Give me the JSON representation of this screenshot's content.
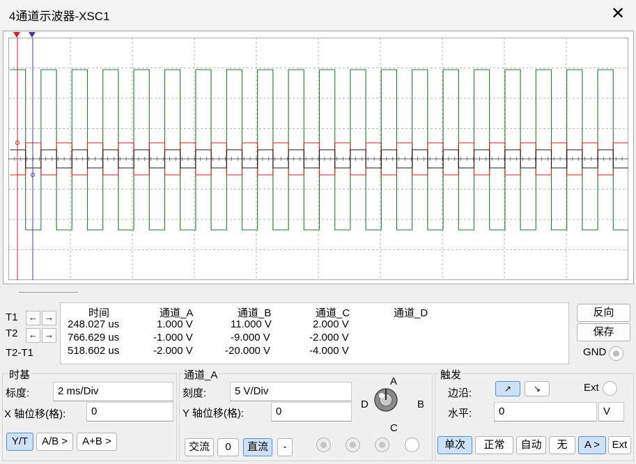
{
  "window": {
    "title": "4通道示波器-XSC1",
    "close_glyph": "✕"
  },
  "colors": {
    "channel_a": "#d42020",
    "channel_b": "#1e7d2e",
    "channel_c": "#1a1a1a",
    "cursor_t1": "#d42020",
    "cursor_t2": "#3a3aa8",
    "grid": "#a0a0a0"
  },
  "cursors": {
    "t1_flag": "1",
    "t2_flag": "2"
  },
  "readout": {
    "headers": [
      "时间",
      "通道_A",
      "通道_B",
      "通道_C",
      "通道_D"
    ],
    "row_labels": [
      "T1",
      "T2",
      "T2-T1"
    ],
    "rows": [
      [
        "248.027 us",
        "1.000 V",
        "11.000 V",
        "2.000 V",
        ""
      ],
      [
        "766.629 us",
        "-1.000 V",
        "-9.000 V",
        "-2.000 V",
        ""
      ],
      [
        "518.602 us",
        "-2.000 V",
        "-20.000 V",
        "-4.000 V",
        ""
      ]
    ],
    "left_arrow": "←",
    "right_arrow": "→"
  },
  "side_buttons": {
    "reverse": "反向",
    "save": "保存",
    "gnd": "GND"
  },
  "timebase": {
    "title": "时基",
    "scale_label": "标度:",
    "scale_value": "2 ms/Div",
    "xpos_label": "X 轴位移(格):",
    "xpos_value": "0",
    "mode_buttons": [
      "Y/T",
      "A/B >",
      "A+B >"
    ]
  },
  "channel": {
    "title": "通道_A",
    "scale_label": "刻度:",
    "scale_value": "5  V/Div",
    "ypos_label": "Y 轴位移(格):",
    "ypos_value": "0",
    "coupling_buttons": [
      "交流",
      "0",
      "直流",
      "-"
    ],
    "knob_labels": {
      "a": "A",
      "b": "B",
      "c": "C",
      "d": "D"
    }
  },
  "trigger": {
    "title": "触发",
    "edge_label": "边沿:",
    "edge_rising": "↗",
    "edge_falling": "↘",
    "ext_label": "Ext",
    "level_label": "水平:",
    "level_value": "0",
    "level_unit": "V",
    "mode_buttons": [
      "单次",
      "正常",
      "自动",
      "无",
      "A >",
      "Ext"
    ]
  }
}
